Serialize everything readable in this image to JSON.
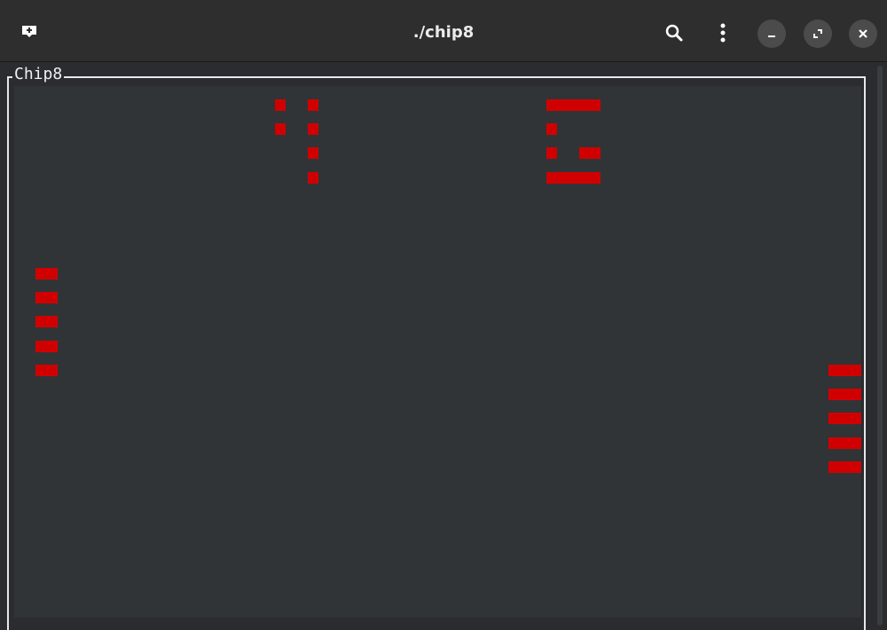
{
  "window": {
    "title": "./chip8"
  },
  "header": {
    "new_tab_icon": "new-tab-icon",
    "search_icon": "search-icon",
    "menu_icon": "kebab-menu-icon",
    "minimize_icon": "minimize-icon",
    "maximize_icon": "maximize-icon",
    "close_icon": "close-icon"
  },
  "terminal": {
    "frame_title": "Chip8",
    "foreground_color": "#d10000",
    "screen_background": "#303436"
  }
}
